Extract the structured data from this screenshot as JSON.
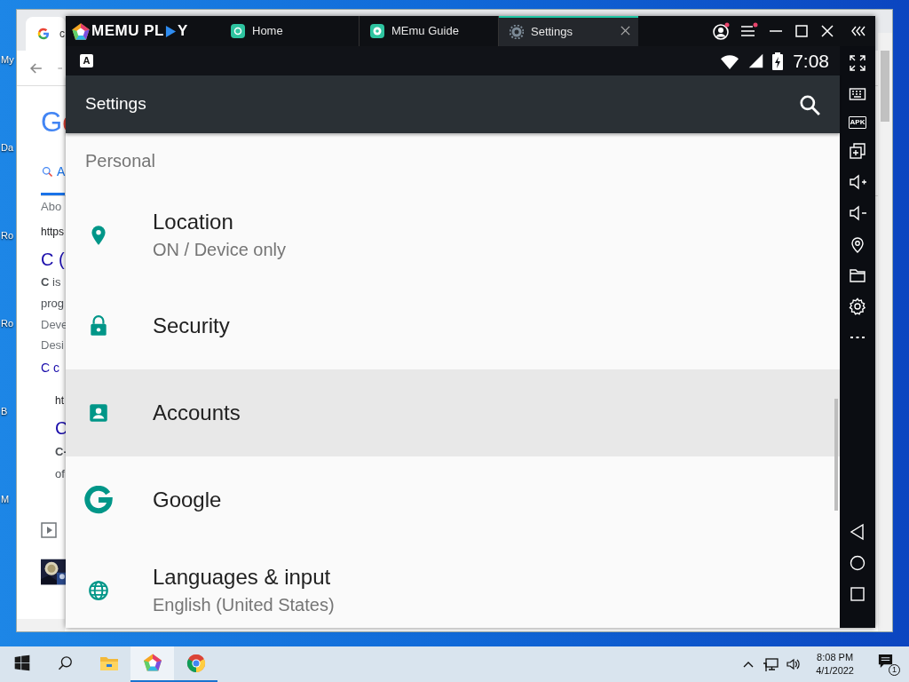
{
  "desktop": {
    "icons": [
      {
        "label": "My"
      },
      {
        "label": "Da"
      },
      {
        "label": "Ro"
      },
      {
        "label": "Ro"
      },
      {
        "label": "B"
      },
      {
        "label": "M"
      }
    ]
  },
  "browser": {
    "tab": {
      "title": "c"
    },
    "lines": [
      {
        "kind": "logo",
        "text": "Go"
      },
      {
        "kind": "search-tab",
        "text": "A"
      },
      {
        "kind": "muted",
        "text": "Abo"
      },
      {
        "kind": "url",
        "text": "https"
      },
      {
        "kind": "link",
        "text": "C ("
      },
      {
        "kind": "body",
        "text": "**C** is"
      },
      {
        "kind": "body",
        "text": "prog"
      },
      {
        "kind": "muted",
        "text": "Deve"
      },
      {
        "kind": "muted",
        "text": "Desi"
      },
      {
        "kind": "sitelink",
        "text": "C c"
      }
    ],
    "nested": [
      {
        "kind": "url",
        "text": "ht"
      },
      {
        "kind": "link",
        "text": "C"
      },
      {
        "kind": "bold",
        "text": "C-"
      },
      {
        "kind": "body",
        "text": "of"
      }
    ]
  },
  "memu": {
    "logo": {
      "before": "MEMU PL",
      "after": "Y"
    },
    "tabs": [
      {
        "label": "Home",
        "selected": false
      },
      {
        "label": "MEmu Guide",
        "selected": false
      },
      {
        "label": "Settings",
        "selected": true
      }
    ],
    "account_alert": true,
    "menu_alert": true
  },
  "status_bar": {
    "notification": "A",
    "time": "7:08"
  },
  "app_bar": {
    "title": "Settings"
  },
  "settings": {
    "header": "Personal",
    "items": [
      {
        "title": "Location",
        "summary": "ON / Device only",
        "selected": false
      },
      {
        "title": "Security",
        "selected": false
      },
      {
        "title": "Accounts",
        "selected": true
      },
      {
        "title": "Google",
        "selected": false
      },
      {
        "title": "Languages & input",
        "summary": "English (United States)",
        "selected": false
      }
    ]
  },
  "sidebar": {
    "apk_label": "APK"
  },
  "taskbar": {
    "apps": [
      {
        "running": false,
        "focused": false
      },
      {
        "running": false,
        "focused": false
      },
      {
        "running": false,
        "focused": false
      },
      {
        "running": true,
        "focused": true
      },
      {
        "running": true,
        "focused": false
      }
    ],
    "time": "8:08 PM",
    "date": "4/1/2022",
    "notifications": "1"
  }
}
